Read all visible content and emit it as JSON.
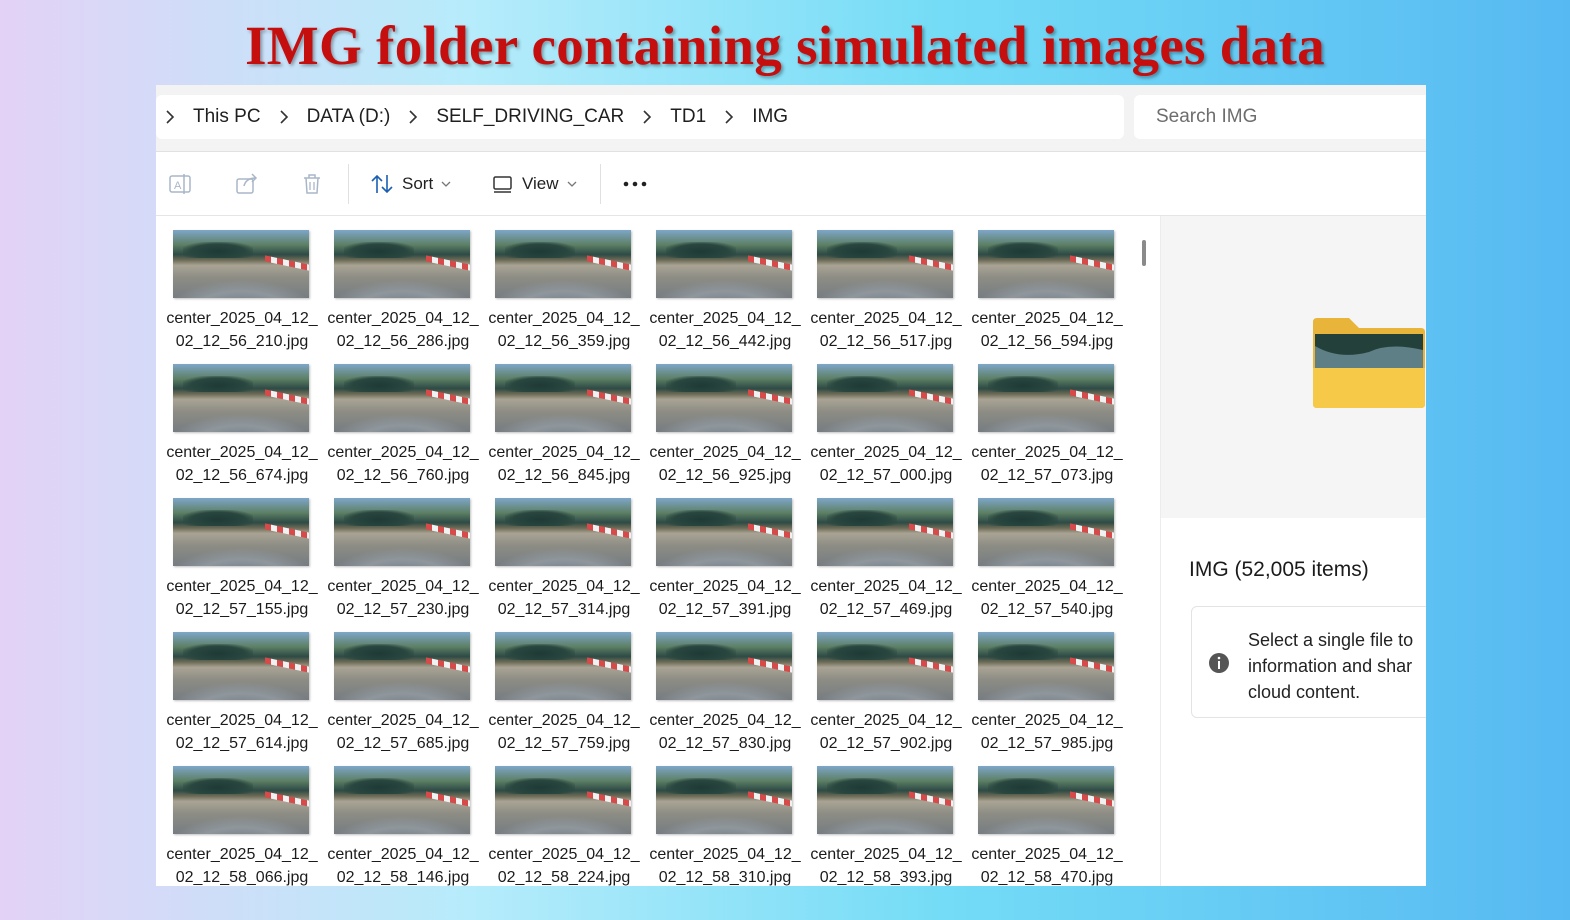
{
  "slide_title": "IMG folder containing simulated images data",
  "breadcrumb": {
    "items": [
      "This PC",
      "DATA (D:)",
      "SELF_DRIVING_CAR",
      "TD1",
      "IMG"
    ]
  },
  "search": {
    "placeholder": "Search IMG"
  },
  "toolbar": {
    "sort_label": "Sort",
    "view_label": "View"
  },
  "files": [
    "center_2025_04_12_02_12_56_210.jpg",
    "center_2025_04_12_02_12_56_286.jpg",
    "center_2025_04_12_02_12_56_359.jpg",
    "center_2025_04_12_02_12_56_442.jpg",
    "center_2025_04_12_02_12_56_517.jpg",
    "center_2025_04_12_02_12_56_594.jpg",
    "center_2025_04_12_02_12_56_674.jpg",
    "center_2025_04_12_02_12_56_760.jpg",
    "center_2025_04_12_02_12_56_845.jpg",
    "center_2025_04_12_02_12_56_925.jpg",
    "center_2025_04_12_02_12_57_000.jpg",
    "center_2025_04_12_02_12_57_073.jpg",
    "center_2025_04_12_02_12_57_155.jpg",
    "center_2025_04_12_02_12_57_230.jpg",
    "center_2025_04_12_02_12_57_314.jpg",
    "center_2025_04_12_02_12_57_391.jpg",
    "center_2025_04_12_02_12_57_469.jpg",
    "center_2025_04_12_02_12_57_540.jpg",
    "center_2025_04_12_02_12_57_614.jpg",
    "center_2025_04_12_02_12_57_685.jpg",
    "center_2025_04_12_02_12_57_759.jpg",
    "center_2025_04_12_02_12_57_830.jpg",
    "center_2025_04_12_02_12_57_902.jpg",
    "center_2025_04_12_02_12_57_985.jpg",
    "center_2025_04_12_02_12_58_066.jpg",
    "center_2025_04_12_02_12_58_146.jpg",
    "center_2025_04_12_02_12_58_224.jpg",
    "center_2025_04_12_02_12_58_310.jpg",
    "center_2025_04_12_02_12_58_393.jpg",
    "center_2025_04_12_02_12_58_470.jpg"
  ],
  "details": {
    "title": "IMG (52,005 items)",
    "info_text": "Select a single file to information and shar cloud content."
  },
  "colors": {
    "title_red": "#c50f0f",
    "folder_yellow": "#f7c948"
  }
}
